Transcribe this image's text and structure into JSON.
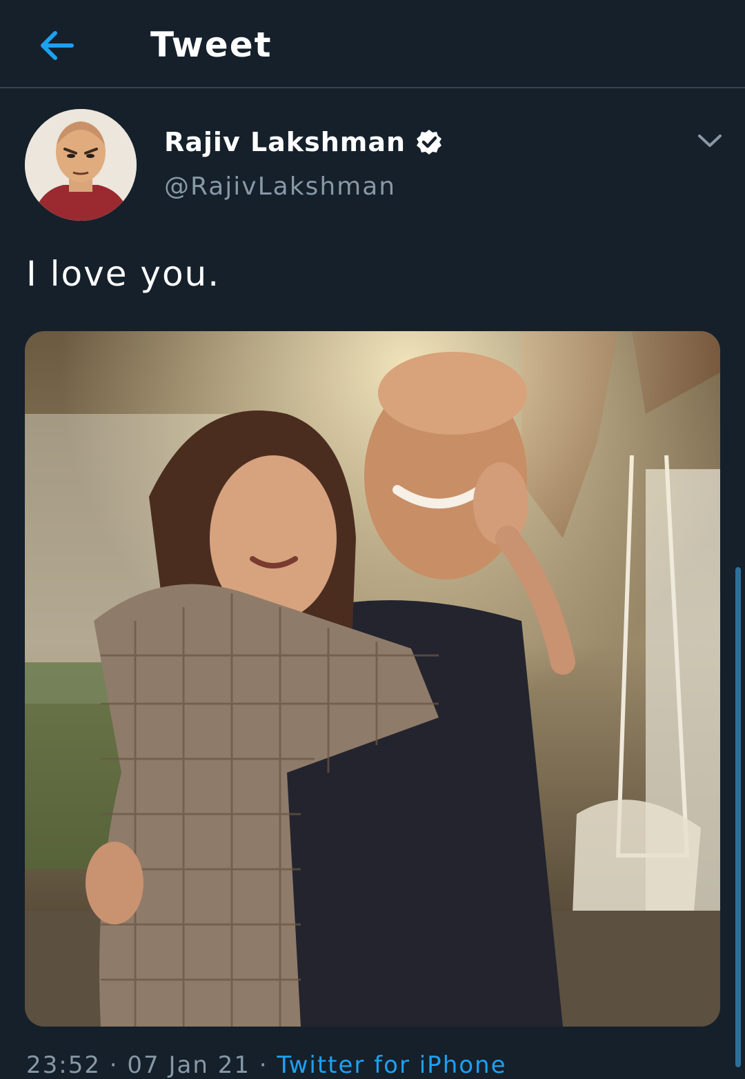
{
  "header": {
    "title": "Tweet",
    "back_icon": "arrow-left-icon",
    "accent_color": "#1da1f2"
  },
  "tweet": {
    "author": {
      "display_name": "Rajiv Lakshman",
      "handle": "@RajivLakshman",
      "verified": true,
      "verified_icon": "verified-badge-icon"
    },
    "menu_icon": "chevron-down-icon",
    "text": "I love you.",
    "media": {
      "type": "photo"
    },
    "meta": {
      "time": "23:52",
      "date": "07 Jan 21",
      "separator": "·",
      "source": "Twitter for iPhone"
    }
  },
  "colors": {
    "background": "#15202b",
    "secondary_text": "#8899a6",
    "divider": "#38444d"
  }
}
